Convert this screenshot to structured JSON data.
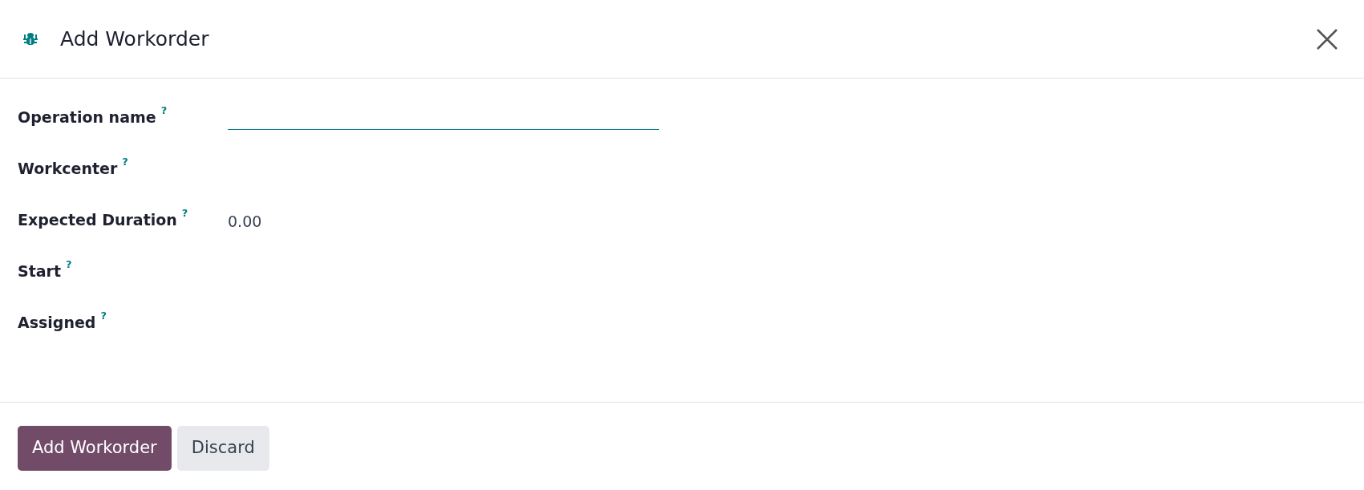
{
  "dialog": {
    "title": "Add Workorder"
  },
  "fields": [
    {
      "label": "Operation name",
      "help": "?",
      "kind": "input"
    },
    {
      "label": "Workcenter",
      "help": "?",
      "kind": "empty"
    },
    {
      "label": "Expected Duration",
      "help": "?",
      "kind": "text",
      "value": "0.00"
    },
    {
      "label": "Start",
      "help": "?",
      "kind": "empty"
    },
    {
      "label": "Assigned",
      "help": "?",
      "kind": "empty"
    }
  ],
  "buttons": [
    {
      "label": "Add Workorder",
      "kind": "primary"
    },
    {
      "label": "Discard",
      "kind": "secondary"
    }
  ]
}
